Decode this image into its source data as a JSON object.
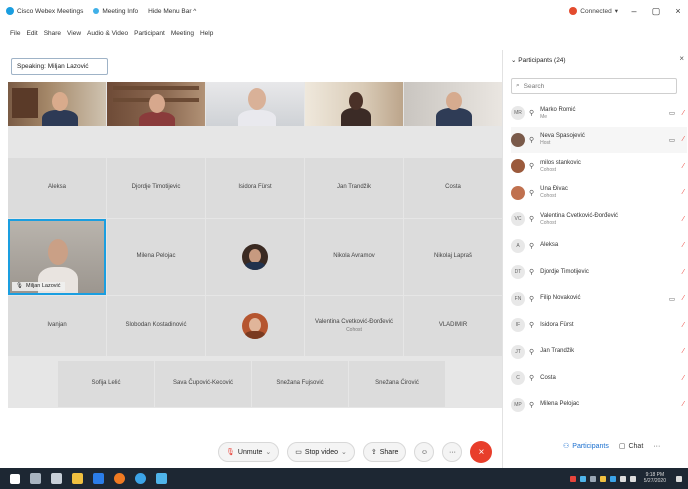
{
  "titlebar": {
    "tabs": [
      "Cisco Webex Meetings",
      "Meeting Info",
      "Hide Menu Bar ^"
    ],
    "status": "Connected",
    "status_caret": "▾",
    "min": "–",
    "restore": "▢",
    "close": "×"
  },
  "menu": [
    "File",
    "Edit",
    "Share",
    "View",
    "Audio & Video",
    "Participant",
    "Meeting",
    "Help"
  ],
  "speaking": "Speaking: Miljan Lazović",
  "grid": {
    "row2": [
      "Aleksa",
      "Djordje Timotijevic",
      "Isidora Fürst",
      "Jan Trandžik",
      "Costa"
    ],
    "row3_mid": [
      "Milena Pelojac",
      "",
      "Nikola Avramov",
      "Nikolaj Lapraš"
    ],
    "self_label": "Miljan Lazović",
    "row4": [
      {
        "name": "Ivanjan",
        "sub": ""
      },
      {
        "name": "Slobodan Kostadinović",
        "sub": ""
      },
      {
        "name": "",
        "sub": ""
      },
      {
        "name": "Valentina Cvetković-Đorđević",
        "sub": "Cohost"
      },
      {
        "name": "VLADIMIR",
        "sub": ""
      }
    ],
    "row5": [
      "Sofija Lelić",
      "Sava Čupović-Kecović",
      "Snežana Fujsović",
      "Snežana Ćirović"
    ]
  },
  "controls": {
    "unmute": "Unmute",
    "stop_video": "Stop video",
    "share": "Share",
    "more": "···",
    "end": "×",
    "caret": "⌄"
  },
  "panel": {
    "title": "Participants (24)",
    "search_placeholder": "Search",
    "items": [
      {
        "initials": "MR",
        "name": "Marko Romić",
        "role": "Me",
        "cam": true
      },
      {
        "initials": "",
        "name": "Neva Spasojević",
        "role": "Host",
        "cam": true
      },
      {
        "initials": "",
        "name": "milos stankovic",
        "role": "Cohost",
        "cam": false
      },
      {
        "initials": "",
        "name": "Una Ðivac",
        "role": "Cohost",
        "cam": false
      },
      {
        "initials": "VC",
        "name": "Valentina Cvetković-Đorđević",
        "role": "Cohost",
        "cam": false
      },
      {
        "initials": "A",
        "name": "Aleksa",
        "role": "",
        "cam": false
      },
      {
        "initials": "DT",
        "name": "Djordje Timotijevic",
        "role": "",
        "cam": false
      },
      {
        "initials": "FN",
        "name": "Filip Novaković",
        "role": "",
        "cam": true
      },
      {
        "initials": "IF",
        "name": "Isidora Fürst",
        "role": "",
        "cam": false
      },
      {
        "initials": "JT",
        "name": "Jan Trandžik",
        "role": "",
        "cam": false
      },
      {
        "initials": "C",
        "name": "Costa",
        "role": "",
        "cam": false
      },
      {
        "initials": "MP",
        "name": "Milena Pelojac",
        "role": "",
        "cam": false
      }
    ],
    "participants_btn": "Participants",
    "chat_btn": "Chat",
    "more_btn": "···"
  },
  "taskbar": {
    "time": "9:18 PM",
    "date": "5/27/2020"
  },
  "colors": {
    "accent": "#1a9ee0",
    "end_call": "#e83e2b",
    "taskbar": "#1d2733",
    "status_red": "#e34b2e"
  }
}
